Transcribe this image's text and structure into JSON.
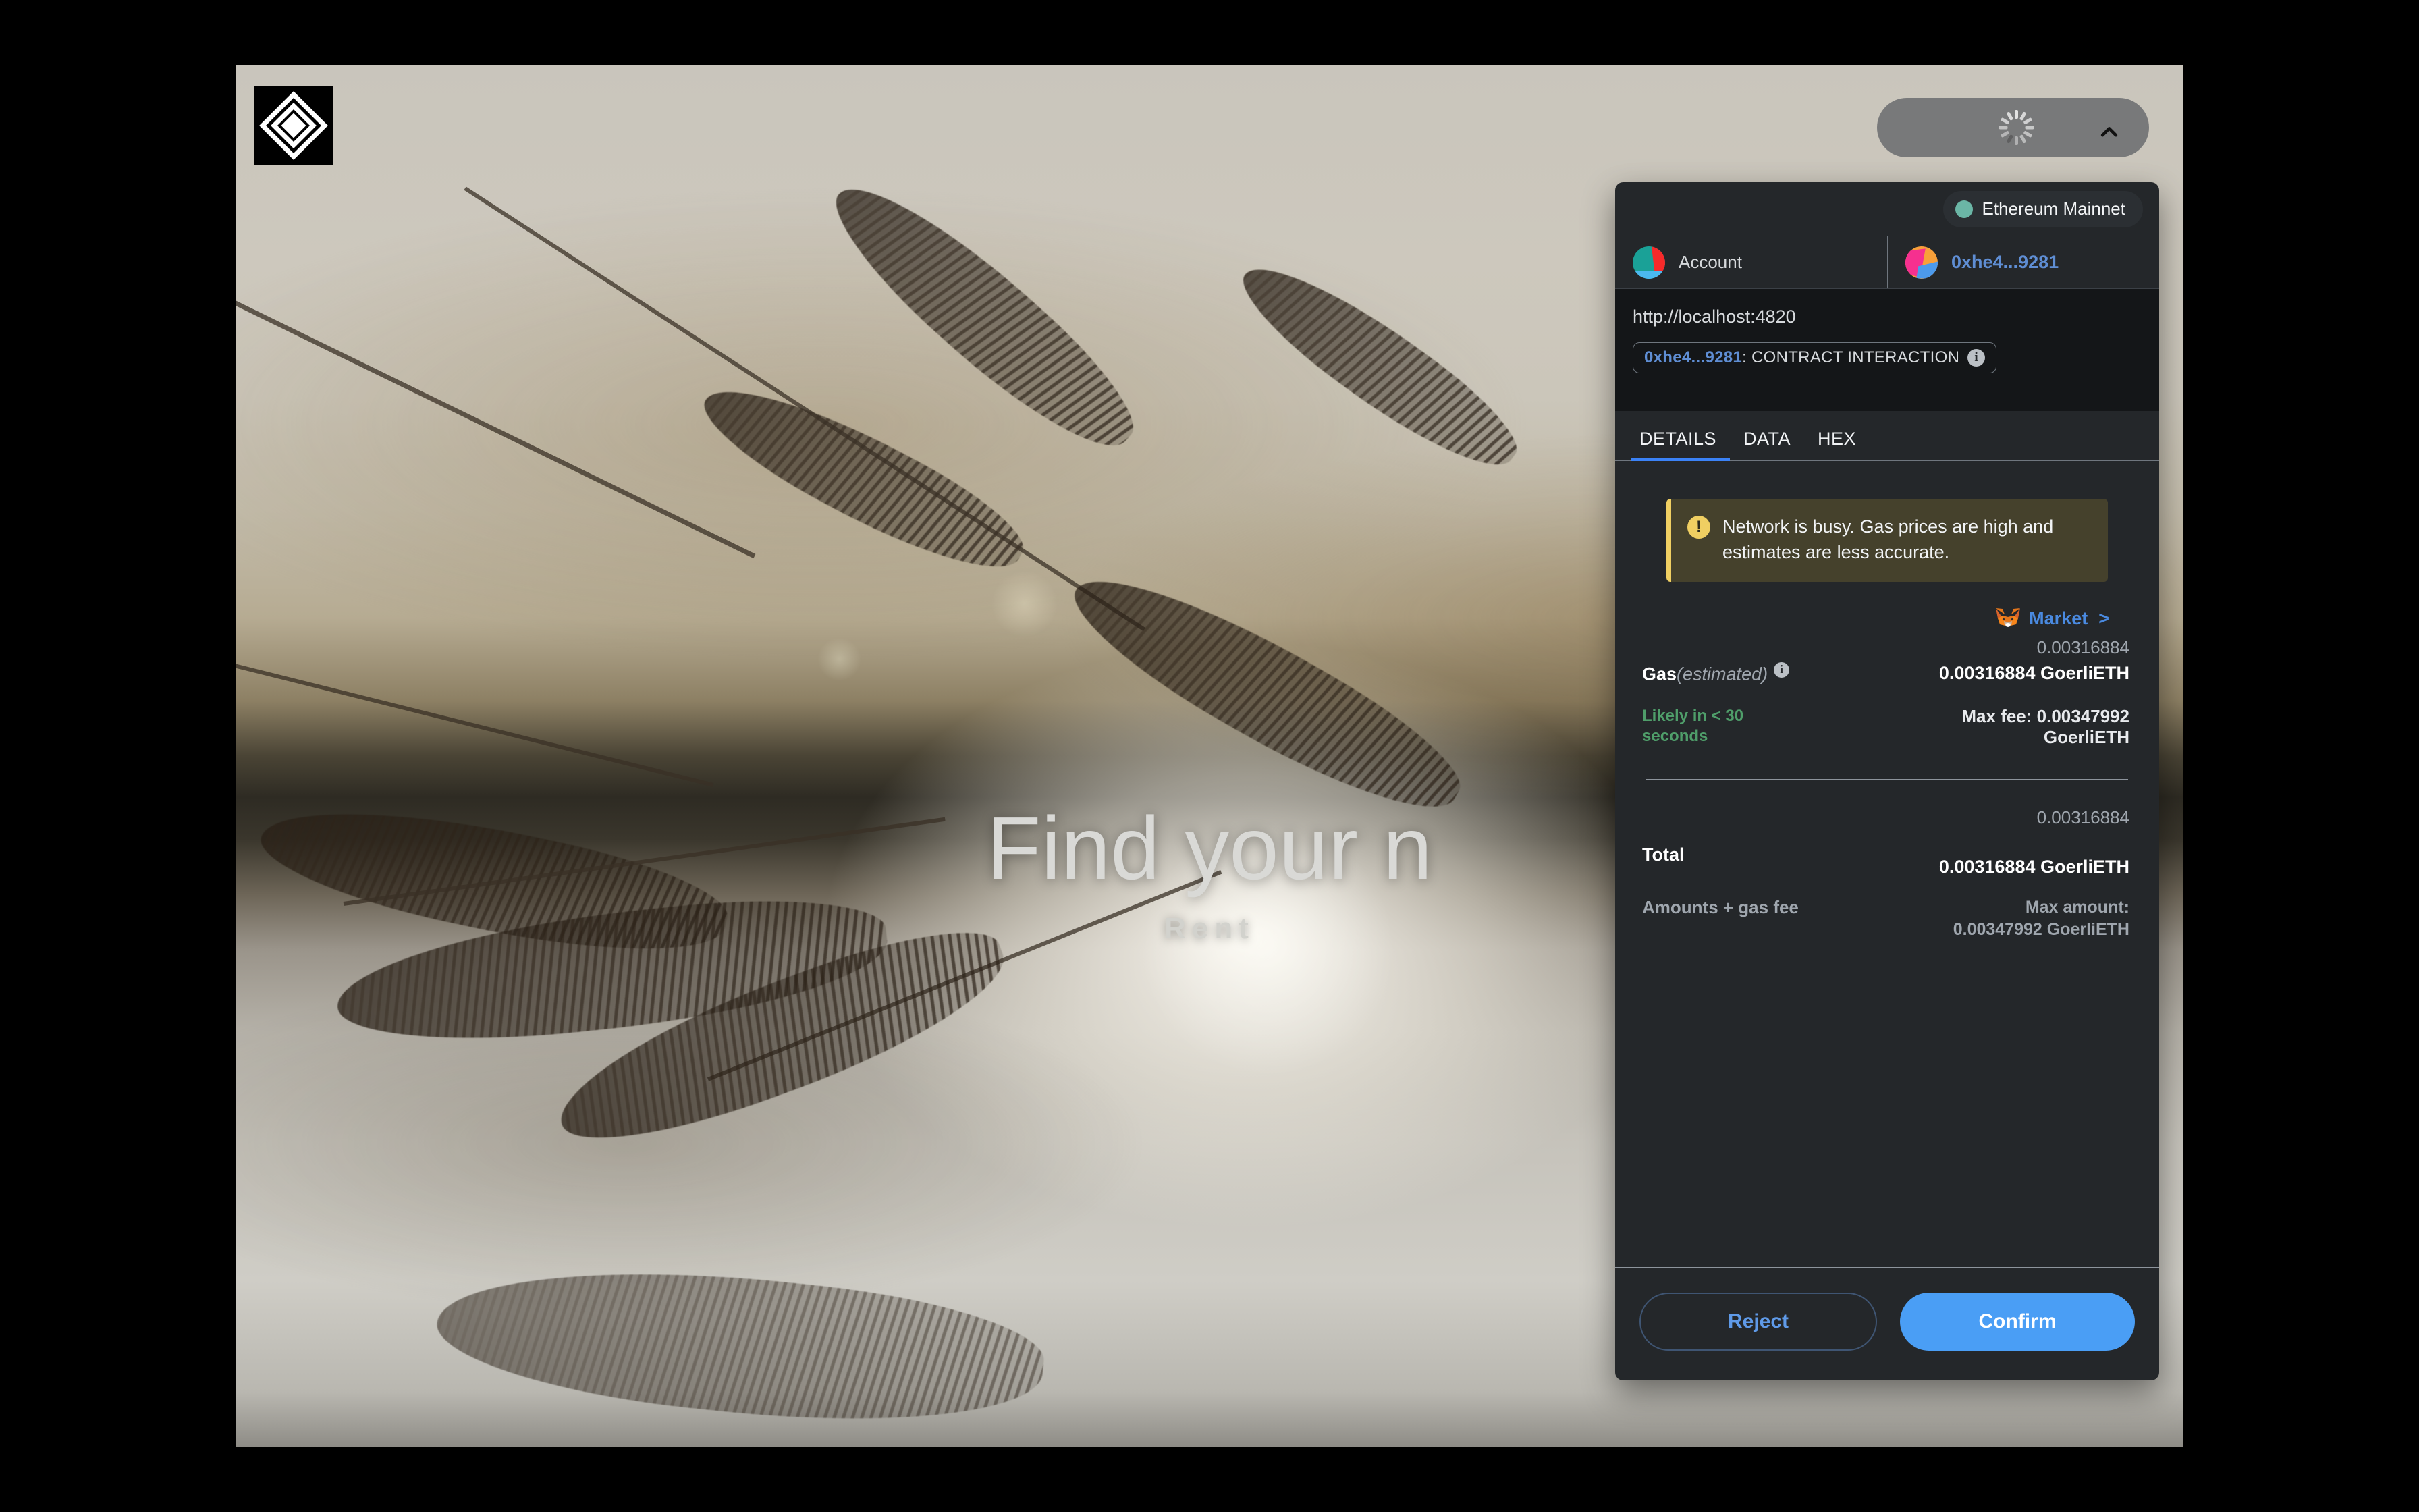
{
  "site": {
    "logo_icon": "diamond-logo-icon",
    "hero_title": "Find your n",
    "hero_subtitle": "Rent"
  },
  "browser_pill": {
    "spinner_icon": "loading-spinner-icon",
    "chevron_icon": "chevron-up-icon"
  },
  "wallet": {
    "network": {
      "name": "Ethereum Mainnet",
      "dot_color": "#6bb6a6",
      "status_icon": "network-status-dot-icon"
    },
    "account": {
      "label": "Account",
      "address": "0xhe4...9281",
      "avatar_icon": "account-jazzicon-avatar",
      "recipient_avatar_icon": "recipient-jazzicon-avatar"
    },
    "origin": {
      "url": "http://localhost:4820",
      "contract_address": "0xhe4...9281",
      "contract_action": ": CONTRACT INTERACTION",
      "info_icon": "info-icon",
      "contract_avatar_icon": "contract-jazzicon-avatar"
    },
    "tabs": [
      {
        "label": "DETAILS",
        "active": true
      },
      {
        "label": "DATA",
        "active": false
      },
      {
        "label": "HEX",
        "active": false
      }
    ],
    "warning": {
      "icon": "warning-exclamation-icon",
      "text": "Network is busy. Gas prices are high and estimates are less accurate.",
      "accent_color": "#f0cf62"
    },
    "market": {
      "fox_icon": "metamask-fox-icon",
      "label": "Market",
      "caret": ">",
      "link_color": "#4a8ae0"
    },
    "gas": {
      "top_amount": "0.00316884",
      "label": "Gas",
      "label_suffix": "(estimated)",
      "info_icon": "info-icon",
      "amount": "0.00316884 GoerliETH",
      "speed": "Likely in < 30 seconds",
      "max_fee": "Max fee: 0.00347992 GoerliETH",
      "speed_color": "#4f9e6a"
    },
    "total": {
      "top_amount": "0.00316884",
      "label": "Total",
      "amount": "0.00316884 GoerliETH",
      "sub_label": "Amounts + gas fee",
      "max_label": "Max amount:",
      "max_amount": "0.00347992 GoerliETH"
    },
    "footer": {
      "reject_label": "Reject",
      "confirm_label": "Confirm",
      "confirm_color": "#4a9ef5"
    }
  }
}
